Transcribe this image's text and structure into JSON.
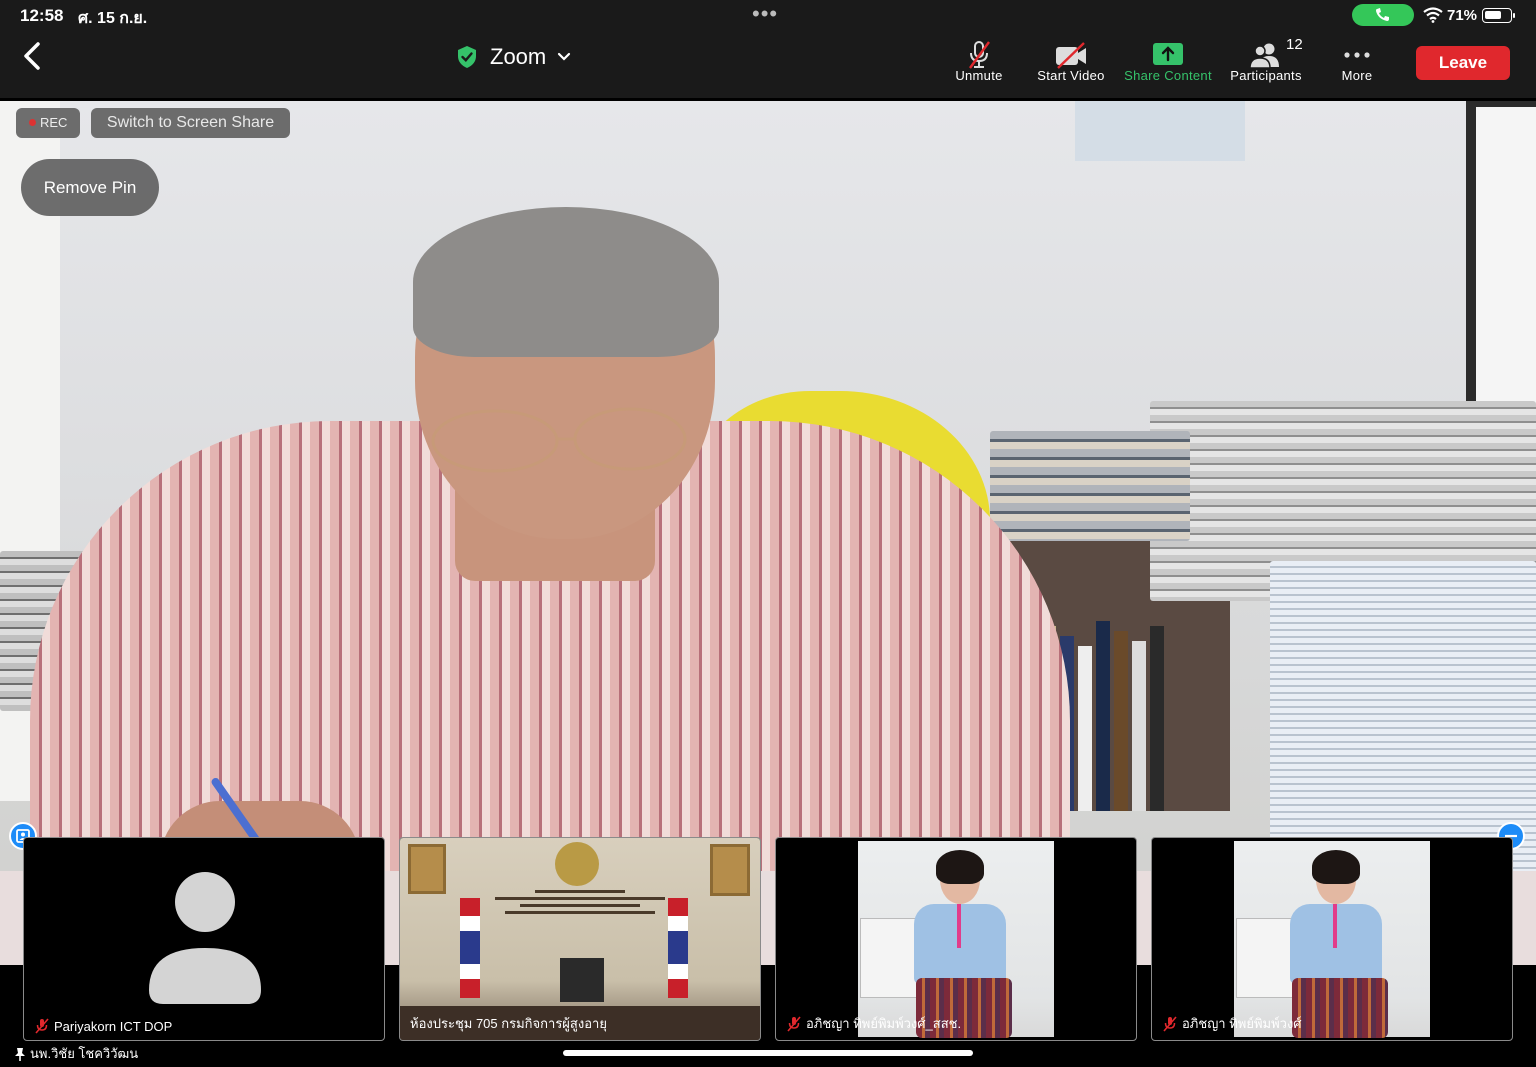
{
  "status_bar": {
    "time": "12:58",
    "date": "ศ. 15 ก.ย.",
    "battery_percent": "71%",
    "battery_level": 0.71,
    "call_active_color": "#34c759"
  },
  "toolbar": {
    "meeting_title": "Zoom",
    "back_icon": "chevron-left-icon",
    "secure_icon": "shield-check-icon",
    "dropdown_icon": "chevron-down-icon",
    "unmute_label": "Unmute",
    "start_video_label": "Start Video",
    "share_content_label": "Share Content",
    "participants_label": "Participants",
    "participants_count": "12",
    "more_label": "More",
    "leave_label": "Leave",
    "share_color": "#35c26a",
    "leave_color": "#e0282d"
  },
  "main_video": {
    "rec_label": "REC",
    "switch_label": "Switch to Screen Share",
    "remove_pin_label": "Remove Pin"
  },
  "thumbnails": [
    {
      "name": "Pariyakorn ICT DOP",
      "muted": true
    },
    {
      "name": "ห้องประชุม 705 กรมกิจการผู้สูงอายุ",
      "muted": false
    },
    {
      "name": "อภิชญา ทิพย์พิมพ์วงศ์_สสช.",
      "muted": true
    },
    {
      "name": "อภิชญา ทิพย์พิมพ์วงศ์",
      "muted": true
    }
  ],
  "pinned_name": "นพ.วิชัย โชควิวัฒน"
}
